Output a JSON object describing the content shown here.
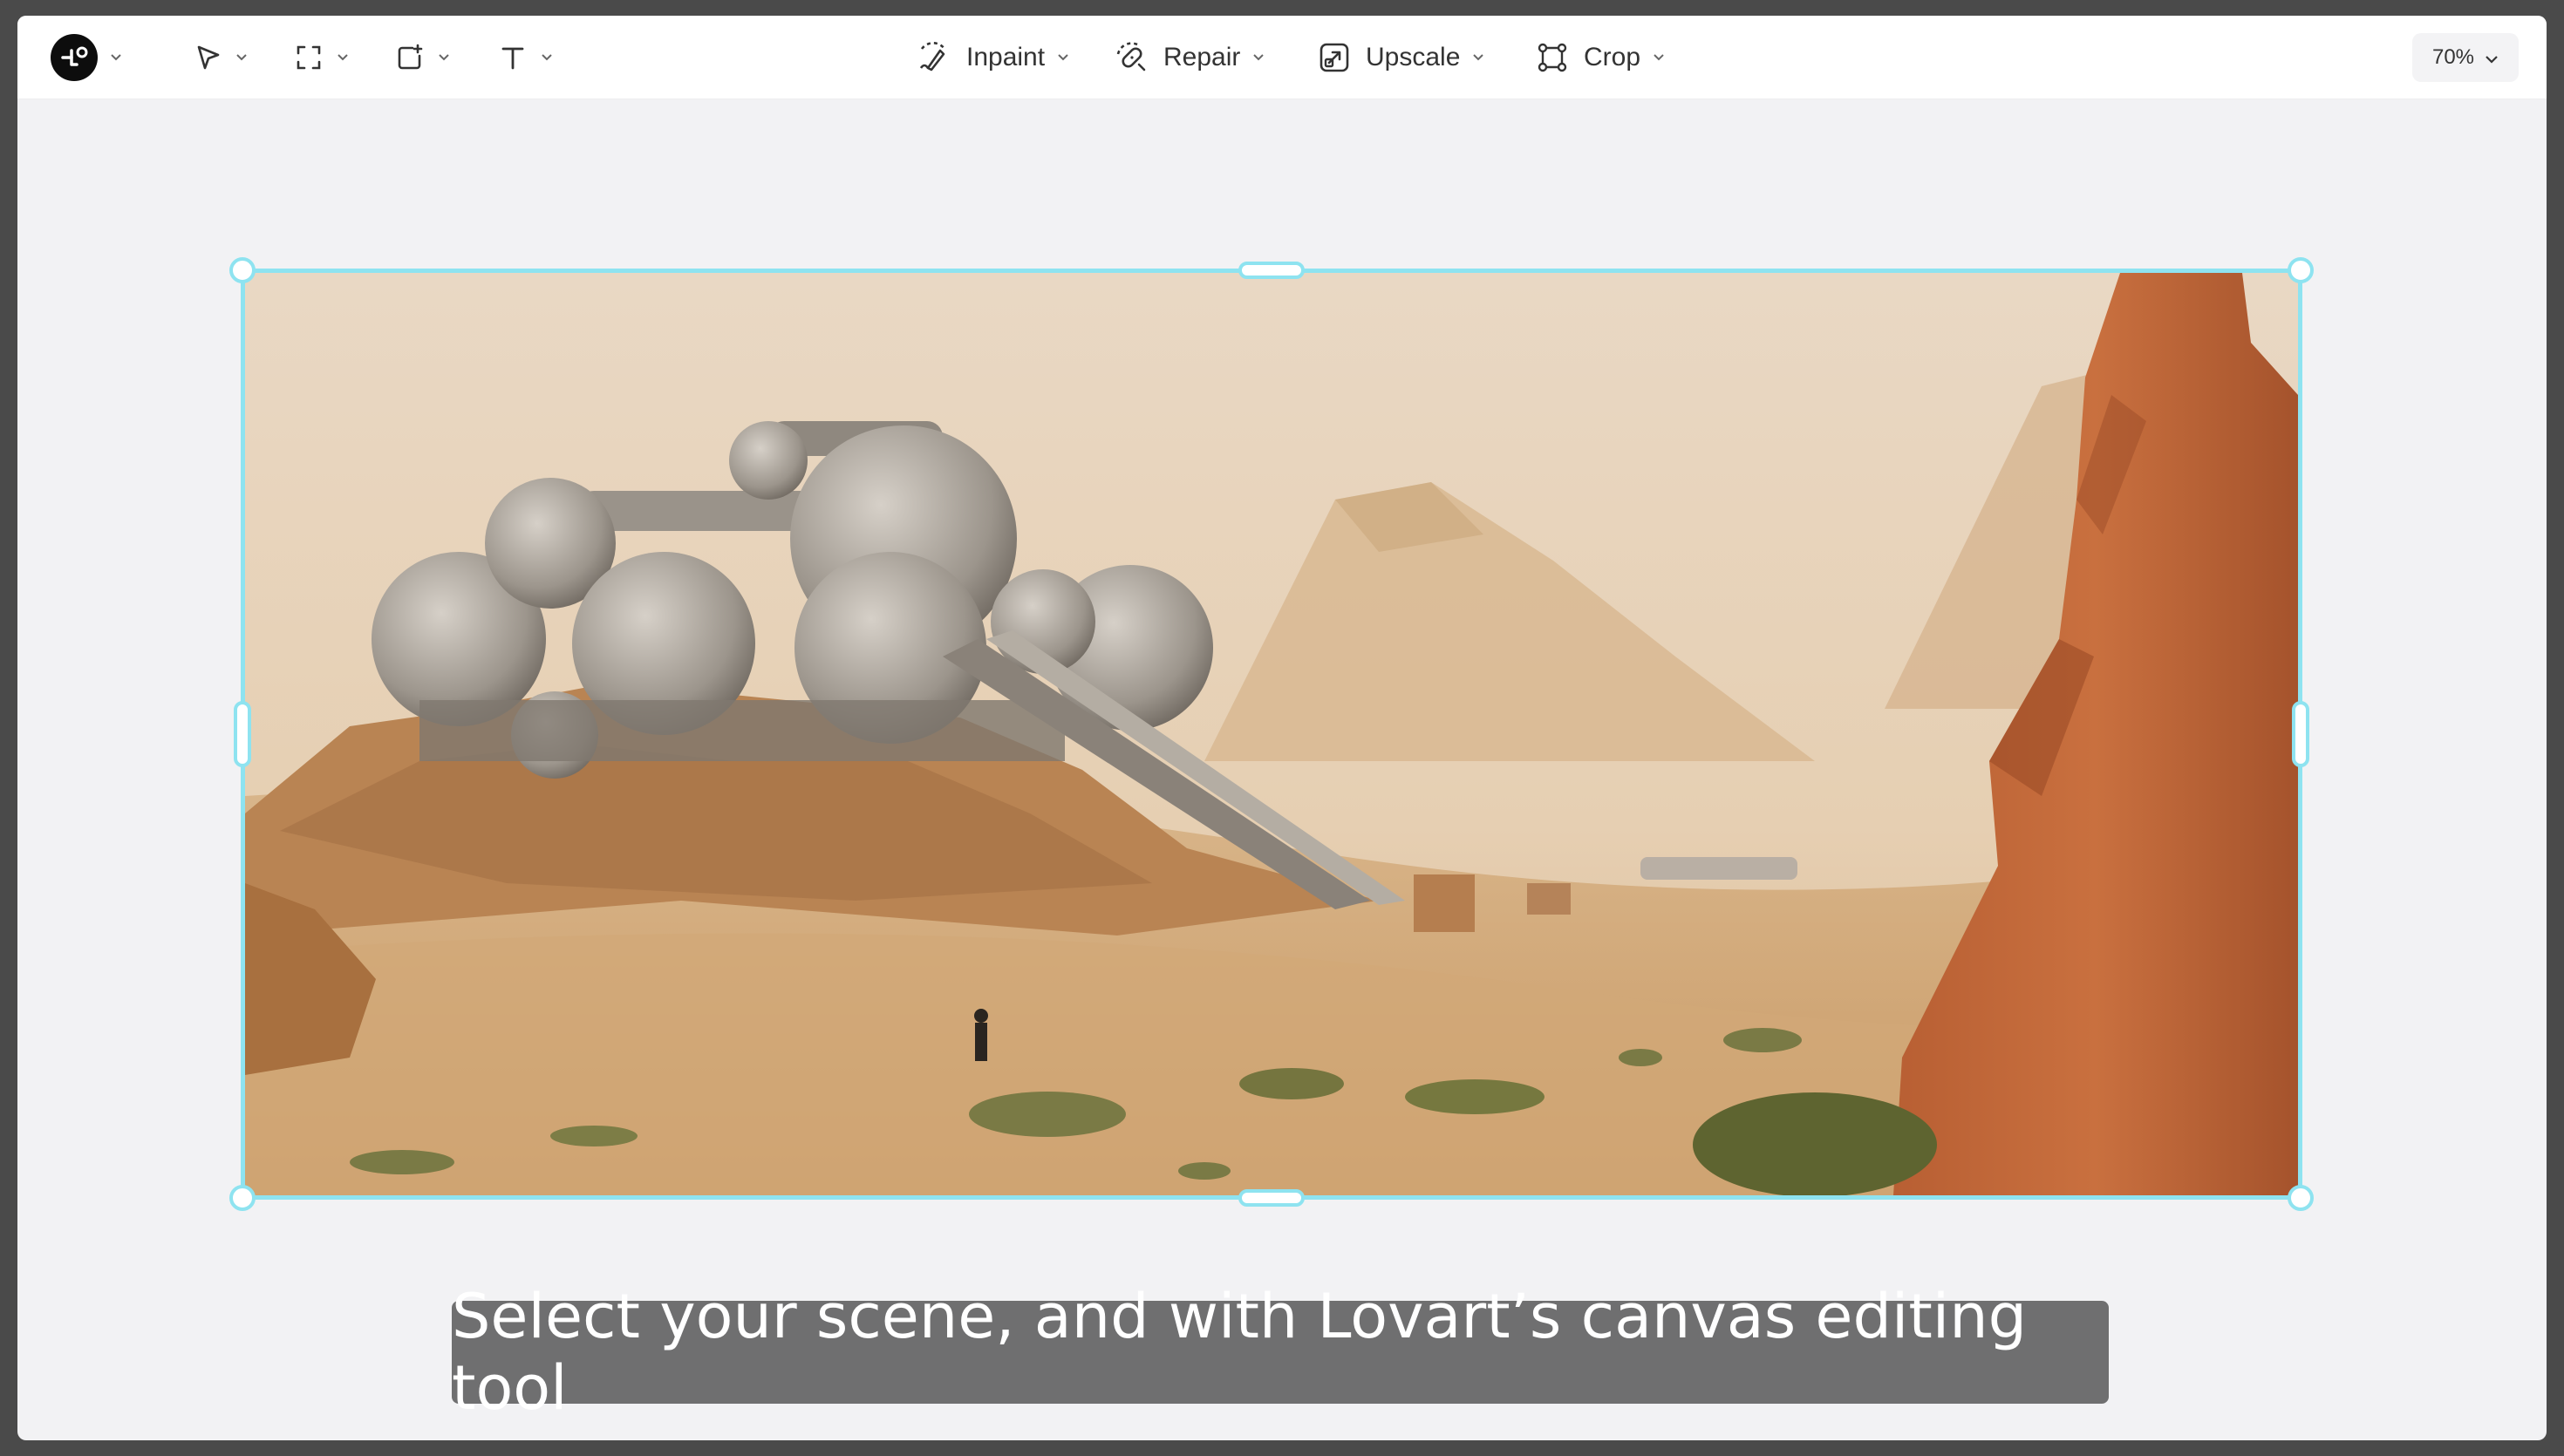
{
  "toolbar": {
    "tools": [
      {
        "name": "select",
        "icon": "pointer-icon"
      },
      {
        "name": "frame",
        "icon": "frame-icon"
      },
      {
        "name": "shape",
        "icon": "shape-add-icon"
      },
      {
        "name": "text",
        "icon": "text-icon"
      }
    ],
    "actions": [
      {
        "label": "Inpaint",
        "icon": "inpaint-icon"
      },
      {
        "label": "Repair",
        "icon": "repair-icon"
      },
      {
        "label": "Upscale",
        "icon": "upscale-icon"
      },
      {
        "label": "Crop",
        "icon": "crop-icon"
      }
    ],
    "zoom": "70%"
  },
  "canvas": {
    "selection_color": "#8ee3f0",
    "image_description_icon": "desert-scene-image"
  },
  "caption": {
    "text": "Select your scene, and with Lovart’s canvas editing tool"
  }
}
